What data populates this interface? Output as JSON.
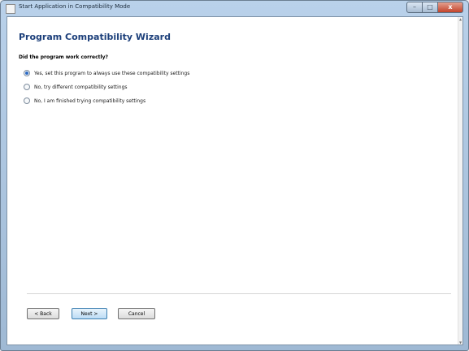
{
  "window": {
    "title": "Start Application in Compatibility Mode"
  },
  "caption_buttons": {
    "minimize": "–",
    "maximize": "□",
    "close": "x"
  },
  "wizard": {
    "header": "Program Compatibility Wizard",
    "question": "Did the program work correctly?",
    "options": [
      {
        "label": "Yes, set this program to always use these compatibility settings",
        "selected": true
      },
      {
        "label": "No, try different compatibility settings",
        "selected": false
      },
      {
        "label": "No, I am finished trying compatibility settings",
        "selected": false
      }
    ]
  },
  "buttons": {
    "back": "< Back",
    "next": "Next >",
    "cancel": "Cancel"
  },
  "colors": {
    "header_text": "#1c3f7a",
    "close_button": "#c3432b"
  }
}
